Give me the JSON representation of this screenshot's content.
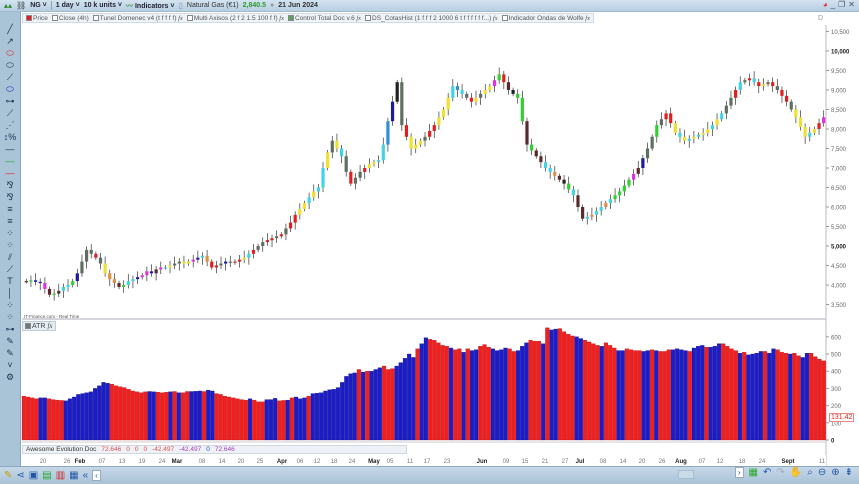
{
  "toolbar": {
    "symbol": "NG",
    "interval": "1 day",
    "units": "10 k units",
    "indicators": "Indicators",
    "instrument": "Natural Gas (€1)",
    "price": "2,840.5",
    "date": "21 Jun 2024"
  },
  "legend": {
    "items": [
      {
        "label": "Price",
        "checked": true,
        "color": "#e02020"
      },
      {
        "label": "Close (4h)"
      },
      {
        "label": "Tunel Domenec v4 (t f f f f)"
      },
      {
        "label": "Multi Axisos (2 f 2 1.5 100 f f)"
      },
      {
        "label": "Control Total Doc v.6",
        "color": "#60a060"
      },
      {
        "label": "DS_CotasHist (1 f f f 2 1000 6 t f f f f f f...)"
      },
      {
        "label": "Indicador Ondas de Wolfe"
      }
    ],
    "right_label": "D"
  },
  "source_label": "IT-Finance.com - Real Time",
  "atr_label": "ATR",
  "atr_current": "131.42",
  "awesome": {
    "name": "Awesome Evolution Doc",
    "values": [
      {
        "v": "72.646",
        "c": "#e05050"
      },
      {
        "v": "0",
        "c": "#e05050"
      },
      {
        "v": "0",
        "c": "#e05050"
      },
      {
        "v": "0",
        "c": "#e05050"
      },
      {
        "v": "-42.497",
        "c": "#e05050"
      },
      {
        "v": "-42.497",
        "c": "#a040c0"
      },
      {
        "v": "0",
        "c": "#2050c0"
      },
      {
        "v": "72.646",
        "c": "#a040c0"
      }
    ]
  },
  "price_axis": {
    "ticks": [
      3500,
      4000,
      4500,
      5000,
      5500,
      6000,
      6500,
      7000,
      7500,
      8000,
      8500,
      9000,
      9500,
      10000,
      10500
    ],
    "bold": [
      5000,
      10000
    ]
  },
  "atr_axis": {
    "ticks": [
      0,
      100,
      200,
      300,
      400,
      500,
      600
    ]
  },
  "date_axis": [
    "20",
    "26",
    "Feb",
    "07",
    "13",
    "19",
    "24",
    "Mar",
    "08",
    "14",
    "20",
    "25",
    "Apr",
    "06",
    "12",
    "18",
    "24",
    "May",
    "05",
    "11",
    "17",
    "23",
    "Jun",
    "09",
    "15",
    "21",
    "27",
    "Jul",
    "08",
    "14",
    "20",
    "26",
    "Aug",
    "07",
    "12",
    "18",
    "24",
    "Sept",
    "11"
  ],
  "colors": {
    "d": "#5f6f5f",
    "r": "#e02020",
    "y": "#f0e030",
    "c": "#40d4e4",
    "s": "#3090d0",
    "b": "#1a1aa0",
    "m": "#e030e0",
    "g": "#30d030",
    "o": "#e09040",
    "n": "#5a2a2a",
    "k": "#202020",
    "atr_up": "#1c1cc8",
    "atr_down": "#f02020"
  },
  "chart_data": [
    {
      "type": "candlestick",
      "ylim": [
        3300,
        10700
      ],
      "closes": [
        4100,
        4120,
        4080,
        4050,
        3900,
        3750,
        3780,
        3850,
        3950,
        4000,
        4100,
        4300,
        4600,
        4900,
        4800,
        4700,
        4550,
        4300,
        4150,
        4050,
        3950,
        4000,
        4100,
        4150,
        4200,
        4250,
        4350,
        4300,
        4400,
        4450,
        4450,
        4500,
        4550,
        4600,
        4550,
        4600,
        4650,
        4700,
        4750,
        4600,
        4450,
        4500,
        4550,
        4600,
        4580,
        4600,
        4650,
        4700,
        4800,
        4900,
        5000,
        5100,
        5150,
        5200,
        5250,
        5300,
        5450,
        5600,
        5800,
        5950,
        6100,
        6250,
        6400,
        6500,
        7000,
        7400,
        7700,
        7500,
        7300,
        6900,
        6600,
        6750,
        6900,
        7000,
        7100,
        7150,
        7200,
        7600,
        8200,
        8700,
        9200,
        8100,
        7800,
        7500,
        7600,
        7700,
        7800,
        7950,
        8100,
        8300,
        8500,
        8800,
        9100,
        9000,
        8900,
        8800,
        8700,
        8800,
        8900,
        9000,
        9100,
        9250,
        9400,
        9200,
        9000,
        8900,
        8800,
        8200,
        7600,
        7450,
        7300,
        7150,
        7000,
        6900,
        6800,
        6700,
        6600,
        6450,
        6300,
        6000,
        5700,
        5750,
        5800,
        5900,
        6000,
        6100,
        6200,
        6300,
        6400,
        6550,
        6700,
        6850,
        7000,
        7250,
        7500,
        7800,
        8100,
        8250,
        8400,
        8150,
        7900,
        7800,
        7700,
        7750,
        7800,
        7850,
        7900,
        8000,
        8100,
        8250,
        8400,
        8600,
        8800,
        9000,
        9200,
        9250,
        9300,
        9200,
        9100,
        9150,
        9200,
        9100,
        9000,
        8850,
        8700,
        8500,
        8300,
        8050,
        7800,
        7900,
        8000,
        8150,
        8300
      ],
      "candle_colors": "ngbbmngnccgbdddrdyoongccbmmbnmcyddyymbcorrdbdrrycrddrrdrdrryycyccydycdrddryyccsbkdryyydrryyycscdrydyymgrnkggngnncconkgcnncoccocggggmnbddgdrrycycycyycycddrcdrcrydrdrrdyyycyrmnggggcr"
    },
    {
      "type": "bar",
      "name": "ATR",
      "ylim": [
        0,
        700
      ],
      "values": [
        255,
        250,
        245,
        240,
        245,
        245,
        240,
        235,
        232,
        230,
        228,
        240,
        250,
        265,
        270,
        275,
        280,
        300,
        315,
        335,
        330,
        325,
        315,
        310,
        305,
        295,
        285,
        280,
        275,
        280,
        282,
        280,
        278,
        275,
        278,
        280,
        282,
        275,
        275,
        282,
        282,
        283,
        285,
        282,
        290,
        285,
        270,
        265,
        255,
        250,
        245,
        240,
        235,
        232,
        240,
        232,
        222,
        222,
        235,
        235,
        242,
        228,
        230,
        232,
        245,
        250,
        240,
        245,
        255,
        270,
        272,
        275,
        285,
        292,
        295,
        305,
        335,
        370,
        385,
        390,
        410,
        395,
        400,
        400,
        410,
        420,
        430,
        410,
        415,
        430,
        450,
        475,
        500,
        480,
        530,
        560,
        595,
        585,
        580,
        565,
        550,
        545,
        535,
        525,
        530,
        510,
        530,
        520,
        525,
        545,
        555,
        540,
        530,
        520,
        525,
        535,
        530,
        515,
        520,
        545,
        565,
        580,
        575,
        575,
        560,
        652,
        640,
        645,
        648,
        630,
        615,
        605,
        600,
        590,
        580,
        570,
        560,
        550,
        545,
        565,
        550,
        535,
        520,
        520,
        530,
        525,
        520,
        520,
        515,
        520,
        525,
        520,
        515,
        515,
        525,
        525,
        530,
        525,
        520,
        515,
        535,
        545,
        550,
        540,
        540,
        545,
        560,
        560,
        545,
        530,
        520,
        505,
        510,
        495,
        500,
        505,
        515,
        515,
        505,
        530,
        525,
        510,
        505,
        500,
        505,
        490,
        480,
        505,
        505,
        485,
        470,
        460
      ],
      "bar_colors": "rrrrbbrrrrbbbbbbbbbbbrrrrrrrrrbbrrrbrbrrbbbrbbrrrrrrrrbrrrbbbrrbrbbbrbbbbbbbbbbbrbrbbbrrrbbbbbrbbrrrrrbrrbrbbrrrbbbbrrbbbrrrbrbbrrrrbbrrrrbrrrbbrrrrbbrbrrrbbbbrbbbrbbbrrrrbrbbbbrbbrrrbrrbbrrr"
    }
  ]
}
